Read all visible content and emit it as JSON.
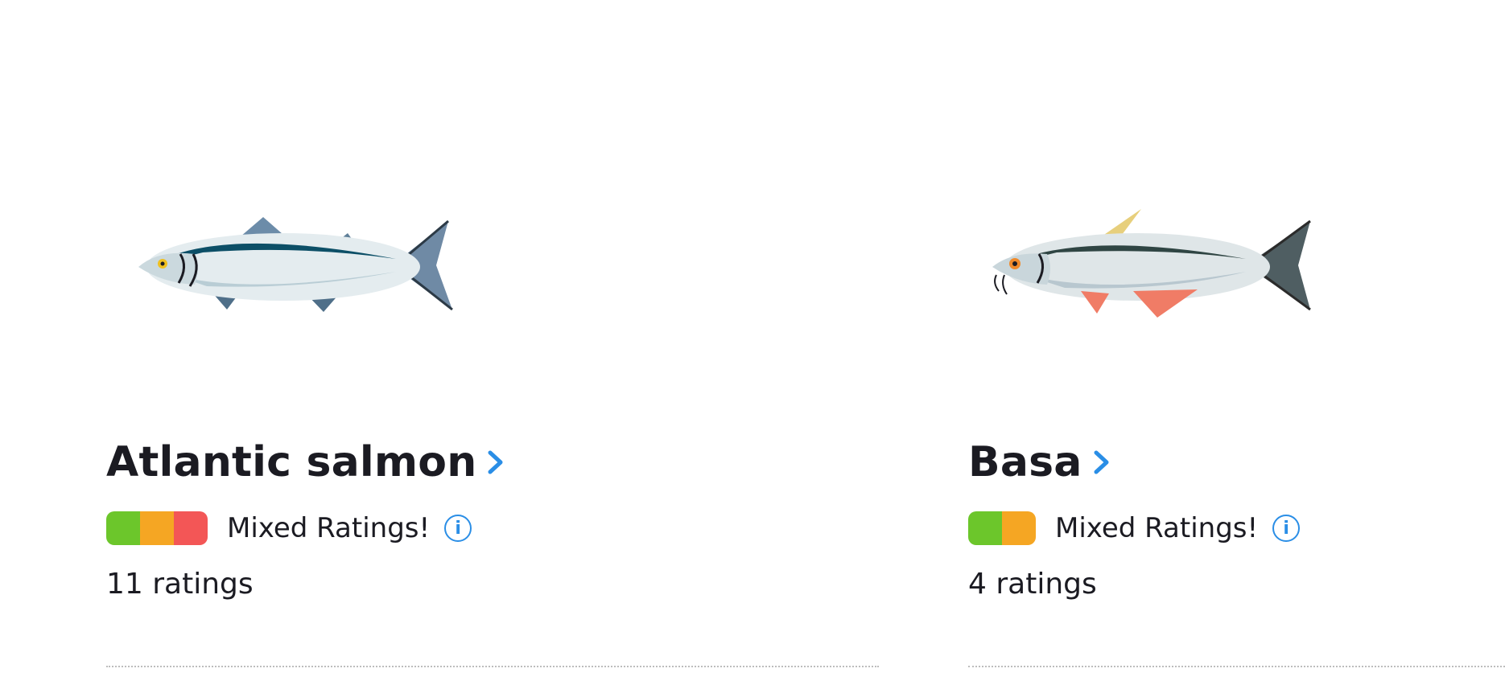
{
  "cards": [
    {
      "name": "Atlantic salmon",
      "rating_label": "Mixed Ratings!",
      "ratings_count": "11 ratings",
      "rating_segments": [
        "#6cc62b",
        "#f5a623",
        "#f35656"
      ],
      "icon": "salmon-illustration"
    },
    {
      "name": "Basa",
      "rating_label": "Mixed Ratings!",
      "ratings_count": "4 ratings",
      "rating_segments": [
        "#6cc62b",
        "#f5a623"
      ],
      "icon": "basa-illustration"
    }
  ],
  "colors": {
    "accent": "#2a8ee6",
    "green": "#6cc62b",
    "orange": "#f5a623",
    "red": "#f35656"
  }
}
